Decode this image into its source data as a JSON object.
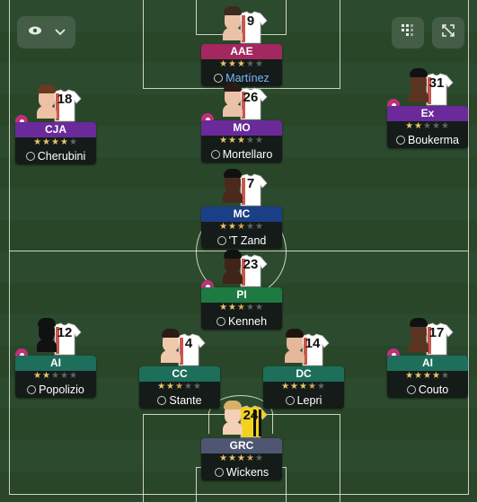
{
  "controls": {
    "view_toggle": "eye-icon",
    "dropdown": "chevron-down-icon",
    "grid_button": "grid-icon",
    "expand_button": "expand-icon"
  },
  "colors": {
    "purple": "#6a2a9a",
    "magenta": "#a3285f",
    "blue": "#1b3f86",
    "green": "#1d7b42",
    "teal": "#1d6f5c",
    "slate": "#4f5672"
  },
  "players": [
    {
      "pos": "AAE",
      "number": "9",
      "name": "Martínez",
      "stars": "★★★☆☆",
      "rating": 3,
      "name_color": "#79b7ff",
      "color": "#a3285f"
    },
    {
      "pos": "CJA",
      "number": "18",
      "name": "Cherubini",
      "stars": "★★★★☆",
      "rating": 4,
      "color": "#6a2a9a"
    },
    {
      "pos": "MO",
      "number": "26",
      "name": "Mortellaro",
      "stars": "★★★☆☆",
      "rating": 3,
      "color": "#6a2a9a"
    },
    {
      "pos": "Ex",
      "number": "31",
      "name": "Boukerma",
      "stars": "★★☆☆☆",
      "rating": 2,
      "color": "#6a2a9a"
    },
    {
      "pos": "MC",
      "number": "7",
      "name": "'T Zand",
      "stars": "★★½☆☆",
      "rating": 2.5,
      "color": "#1b3f86"
    },
    {
      "pos": "PI",
      "number": "23",
      "name": "Kenneh",
      "stars": "★★½☆☆",
      "rating": 2.5,
      "color": "#1d7b42"
    },
    {
      "pos": "AI",
      "number": "12",
      "name": "Popolizio",
      "stars": "★★☆☆☆",
      "rating": 2,
      "color": "#1d6f5c"
    },
    {
      "pos": "CC",
      "number": "4",
      "name": "Stante",
      "stars": "★★½☆☆",
      "rating": 2.5,
      "color": "#1d6f5c"
    },
    {
      "pos": "DC",
      "number": "14",
      "name": "Lepri",
      "stars": "★★★½☆",
      "rating": 3.5,
      "color": "#1d6f5c"
    },
    {
      "pos": "AI",
      "number": "17",
      "name": "Couto",
      "stars": "★★★★☆",
      "rating": 4,
      "color": "#1d6f5c"
    },
    {
      "pos": "GRC",
      "number": "24",
      "name": "Wickens",
      "stars": "★★★½☆",
      "rating": 3.5,
      "color": "#4f5672"
    }
  ]
}
